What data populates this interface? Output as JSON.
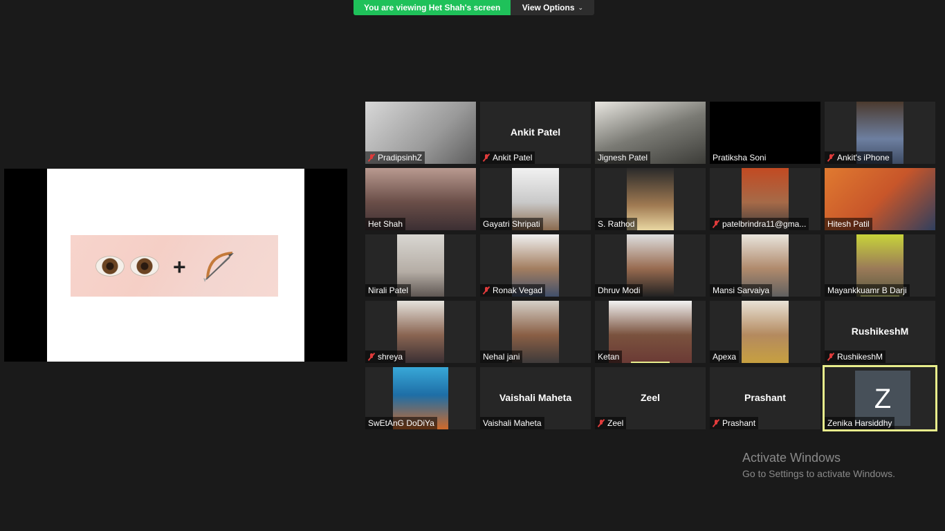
{
  "banner": {
    "viewing_text": "You are viewing Het Shah's screen",
    "view_options_label": "View Options"
  },
  "colors": {
    "banner_green": "#1fc15a",
    "active_speaker_border": "#e8ee8c",
    "mute_red": "#e03b3b",
    "tile_bg": "#262626",
    "avatar_z": "#475059"
  },
  "slide": {
    "content_icons": [
      "eyes-emoji",
      "plus-sign",
      "bow-and-arrow-emoji"
    ],
    "plus": "+"
  },
  "participants": [
    {
      "name": "PradipsinhZ",
      "muted": true,
      "video": true
    },
    {
      "name": "Ankit Patel",
      "muted": true,
      "video": false,
      "display_name": "Ankit Patel"
    },
    {
      "name": "Jignesh Patel",
      "muted": false,
      "video": true
    },
    {
      "name": "Pratiksha Soni",
      "muted": false,
      "video": true
    },
    {
      "name": "Ankit's iPhone",
      "muted": true,
      "video": true
    },
    {
      "name": "Het Shah",
      "muted": false,
      "video": true
    },
    {
      "name": "Gayatri Shripati",
      "muted": false,
      "video": true
    },
    {
      "name": "S. Rathod",
      "muted": false,
      "video": true
    },
    {
      "name": "patelbrindra11@gma...",
      "muted": true,
      "video": true
    },
    {
      "name": "Hitesh Patil",
      "muted": false,
      "video": true
    },
    {
      "name": "Nirali Patel",
      "muted": false,
      "video": true
    },
    {
      "name": "Ronak Vegad",
      "muted": true,
      "video": true
    },
    {
      "name": "Dhruv Modi",
      "muted": false,
      "video": true
    },
    {
      "name": "Mansi Sarvaiya",
      "muted": false,
      "video": true
    },
    {
      "name": "Mayankkuamr B Darji",
      "muted": false,
      "video": true
    },
    {
      "name": "shreya",
      "muted": true,
      "video": true
    },
    {
      "name": "Nehal jani",
      "muted": false,
      "video": true
    },
    {
      "name": "Ketan",
      "muted": false,
      "video": true
    },
    {
      "name": "Apexa",
      "muted": false,
      "video": true
    },
    {
      "name": "RushikeshM",
      "muted": true,
      "video": false,
      "display_name": "RushikeshM"
    },
    {
      "name": "SwEtAnG DoDiYa",
      "muted": false,
      "video": true
    },
    {
      "name": "Vaishali Maheta",
      "muted": false,
      "video": false,
      "display_name": "Vaishali Maheta"
    },
    {
      "name": "Zeel",
      "muted": true,
      "video": false,
      "display_name": "Zeel"
    },
    {
      "name": "Prashant",
      "muted": true,
      "video": false,
      "display_name": "Prashant"
    },
    {
      "name": "Zenika Harsiddhy",
      "muted": false,
      "video": false,
      "avatar_letter": "Z",
      "active_speaker": true
    }
  ],
  "watermark": {
    "title": "Activate Windows",
    "subtitle": "Go to Settings to activate Windows."
  }
}
